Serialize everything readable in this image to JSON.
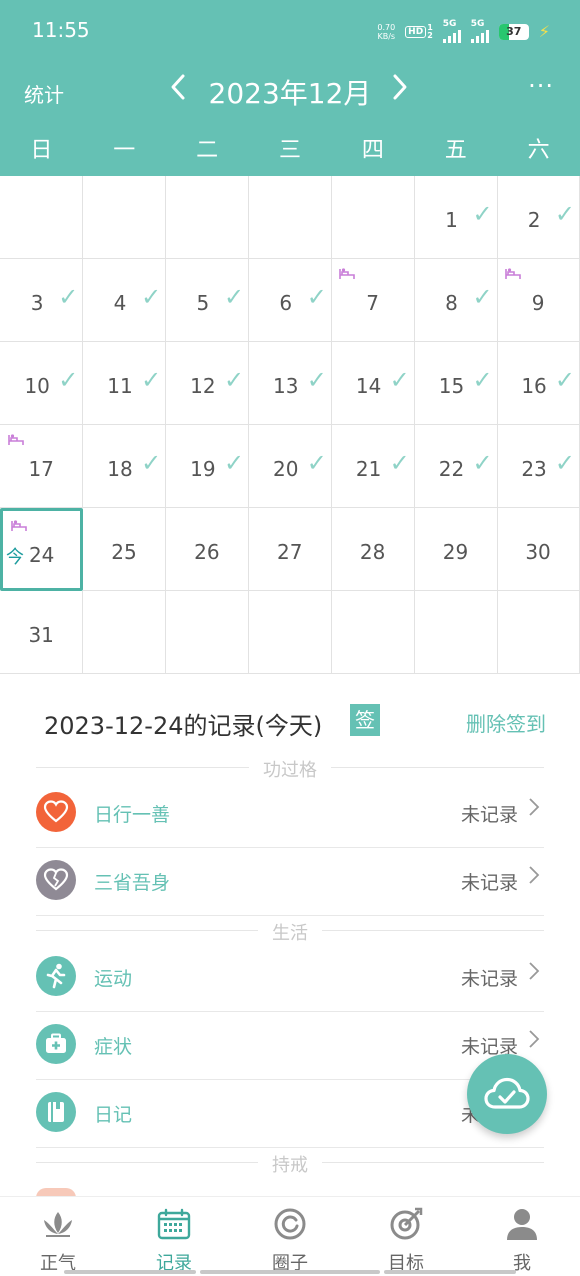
{
  "status_bar": {
    "time": "11:55",
    "net_speed_top": "0.70",
    "net_speed_bottom": "KB/s",
    "hd_label": "HD",
    "sim1": "1",
    "sim2": "2",
    "sig1_label": "5G",
    "sig2_label": "5G",
    "battery": "37"
  },
  "header": {
    "stats_label": "统计",
    "month_title": "2023年12月",
    "prev_icon": "chevron-left-icon",
    "next_icon": "chevron-right-icon",
    "more_label": "···"
  },
  "weekdays": [
    "日",
    "一",
    "二",
    "三",
    "四",
    "五",
    "六"
  ],
  "calendar": {
    "today_label": "今",
    "check_glyph": "✓",
    "rows": [
      [
        {
          "d": ""
        },
        {
          "d": ""
        },
        {
          "d": ""
        },
        {
          "d": ""
        },
        {
          "d": ""
        },
        {
          "d": "1",
          "check": true
        },
        {
          "d": "2",
          "check": true
        }
      ],
      [
        {
          "d": "3",
          "check": true
        },
        {
          "d": "4",
          "check": true
        },
        {
          "d": "5",
          "check": true
        },
        {
          "d": "6",
          "check": true
        },
        {
          "d": "7",
          "mark": true
        },
        {
          "d": "8",
          "check": true
        },
        {
          "d": "9",
          "mark": true
        }
      ],
      [
        {
          "d": "10",
          "check": true
        },
        {
          "d": "11",
          "check": true
        },
        {
          "d": "12",
          "check": true
        },
        {
          "d": "13",
          "check": true
        },
        {
          "d": "14",
          "check": true
        },
        {
          "d": "15",
          "check": true
        },
        {
          "d": "16",
          "check": true
        }
      ],
      [
        {
          "d": "17",
          "mark": true
        },
        {
          "d": "18",
          "check": true
        },
        {
          "d": "19",
          "check": true
        },
        {
          "d": "20",
          "check": true
        },
        {
          "d": "21",
          "check": true
        },
        {
          "d": "22",
          "check": true
        },
        {
          "d": "23",
          "check": true
        }
      ],
      [
        {
          "d": "24",
          "mark": true,
          "today": true
        },
        {
          "d": "25"
        },
        {
          "d": "26"
        },
        {
          "d": "27"
        },
        {
          "d": "28"
        },
        {
          "d": "29"
        },
        {
          "d": "30"
        }
      ],
      [
        {
          "d": "31"
        },
        {
          "d": ""
        },
        {
          "d": ""
        },
        {
          "d": ""
        },
        {
          "d": ""
        },
        {
          "d": ""
        },
        {
          "d": ""
        }
      ]
    ]
  },
  "record": {
    "title": "2023-12-24的记录(今天)",
    "sign_badge": "签",
    "delete_label": "删除签到"
  },
  "sections": {
    "merit": "功过格",
    "life": "生活",
    "precepts": "持戒"
  },
  "items": [
    {
      "name": "日行一善",
      "status": "未记录",
      "icon": "heart-icon",
      "color": "#f2643a"
    },
    {
      "name": "三省吾身",
      "status": "未记录",
      "icon": "broken-heart-icon",
      "color": "#8f8a95"
    },
    {
      "name": "运动",
      "status": "未记录",
      "icon": "running-icon",
      "color": "#65c1b4"
    },
    {
      "name": "症状",
      "status": "未记录",
      "icon": "medical-kit-icon",
      "color": "#65c1b4"
    },
    {
      "name": "日记",
      "status": "未记录",
      "icon": "diary-icon",
      "color": "#65c1b4"
    }
  ],
  "colors": {
    "accent": "#65c1b4",
    "check": "#8fd3c7",
    "mark": "#c97fd8"
  },
  "tabbar": [
    {
      "label": "正气",
      "icon": "lotus-icon"
    },
    {
      "label": "记录",
      "icon": "calendar-icon",
      "active": true
    },
    {
      "label": "圈子",
      "icon": "circle-icon"
    },
    {
      "label": "目标",
      "icon": "target-icon"
    },
    {
      "label": "我",
      "icon": "person-icon"
    }
  ]
}
